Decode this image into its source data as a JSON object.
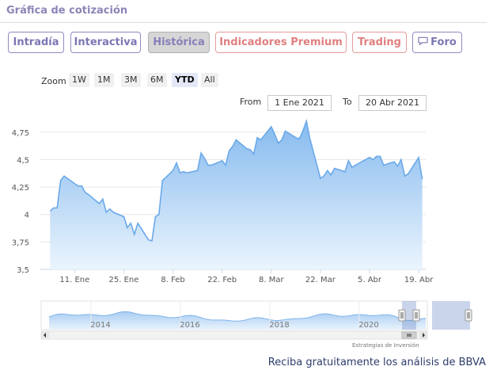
{
  "header": {
    "title": "Gráfica de cotización"
  },
  "tabs": [
    {
      "label": "Intradía",
      "active": false
    },
    {
      "label": "Interactiva",
      "active": false
    },
    {
      "label": "Histórica",
      "active": true
    },
    {
      "label": "Indicadores Premium",
      "active": false
    },
    {
      "label": "Trading",
      "active": false
    },
    {
      "label": "Foro",
      "active": false,
      "icon": "chat-bubble-icon"
    }
  ],
  "zoom": {
    "label": "Zoom",
    "buttons": [
      "1W",
      "1M",
      "3M",
      "6M",
      "YTD",
      "All"
    ],
    "selected": "YTD"
  },
  "range": {
    "from_label": "From",
    "from_value": "1 Ene 2021",
    "to_label": "To",
    "to_value": "20 Abr 2021"
  },
  "chart_data": {
    "type": "area",
    "ylim": [
      3.5,
      4.9
    ],
    "y_ticks": [
      "3,5",
      "3,75",
      "4",
      "4,25",
      "4,5",
      "4,75"
    ],
    "x_ticks": [
      "11. Ene",
      "25. Ene",
      "8. Feb",
      "22. Feb",
      "8. Mar",
      "22. Mar",
      "5. Abr",
      "19. Abr"
    ],
    "x": [
      "2021-01-04",
      "2021-01-05",
      "2021-01-06",
      "2021-01-07",
      "2021-01-08",
      "2021-01-11",
      "2021-01-12",
      "2021-01-13",
      "2021-01-14",
      "2021-01-15",
      "2021-01-18",
      "2021-01-19",
      "2021-01-20",
      "2021-01-21",
      "2021-01-22",
      "2021-01-25",
      "2021-01-26",
      "2021-01-27",
      "2021-01-28",
      "2021-01-29",
      "2021-02-01",
      "2021-02-02",
      "2021-02-03",
      "2021-02-04",
      "2021-02-05",
      "2021-02-08",
      "2021-02-09",
      "2021-02-10",
      "2021-02-11",
      "2021-02-12",
      "2021-02-15",
      "2021-02-16",
      "2021-02-17",
      "2021-02-18",
      "2021-02-19",
      "2021-02-22",
      "2021-02-23",
      "2021-02-24",
      "2021-02-25",
      "2021-02-26",
      "2021-03-01",
      "2021-03-02",
      "2021-03-03",
      "2021-03-04",
      "2021-03-05",
      "2021-03-08",
      "2021-03-09",
      "2021-03-10",
      "2021-03-11",
      "2021-03-12",
      "2021-03-15",
      "2021-03-16",
      "2021-03-17",
      "2021-03-18",
      "2021-03-19",
      "2021-03-22",
      "2021-03-23",
      "2021-03-24",
      "2021-03-25",
      "2021-03-26",
      "2021-03-29",
      "2021-03-30",
      "2021-03-31",
      "2021-04-01",
      "2021-04-05",
      "2021-04-06",
      "2021-04-07",
      "2021-04-08",
      "2021-04-09",
      "2021-04-12",
      "2021-04-13",
      "2021-04-14",
      "2021-04-15",
      "2021-04-16",
      "2021-04-19",
      "2021-04-20"
    ],
    "values": [
      4.03,
      4.06,
      4.06,
      4.31,
      4.35,
      4.28,
      4.26,
      4.26,
      4.2,
      4.18,
      4.1,
      4.14,
      4.02,
      4.05,
      4.02,
      3.98,
      3.88,
      3.92,
      3.82,
      3.92,
      3.77,
      3.76,
      3.98,
      4.0,
      4.31,
      4.4,
      4.47,
      4.38,
      4.39,
      4.38,
      4.4,
      4.56,
      4.51,
      4.45,
      4.45,
      4.49,
      4.45,
      4.58,
      4.62,
      4.68,
      4.6,
      4.59,
      4.55,
      4.7,
      4.68,
      4.8,
      4.73,
      4.65,
      4.68,
      4.76,
      4.7,
      4.69,
      4.76,
      4.85,
      4.69,
      4.33,
      4.35,
      4.4,
      4.36,
      4.42,
      4.39,
      4.49,
      4.43,
      4.45,
      4.52,
      4.5,
      4.53,
      4.53,
      4.45,
      4.48,
      4.44,
      4.5,
      4.35,
      4.37,
      4.52,
      4.32
    ],
    "navigator": {
      "x_ticks": [
        "2014",
        "2016",
        "2018",
        "2020"
      ]
    }
  },
  "credits": "Estrategias de Inversión",
  "footer": {
    "text": "Reciba gratuitamente los análisis de BBVA"
  },
  "colors": {
    "accent": "#7c77b4",
    "line": "#6aa9e9",
    "area_top": "#7fb6ee",
    "area_bottom": "#eaf4fd",
    "premium": "#e07f7f"
  }
}
